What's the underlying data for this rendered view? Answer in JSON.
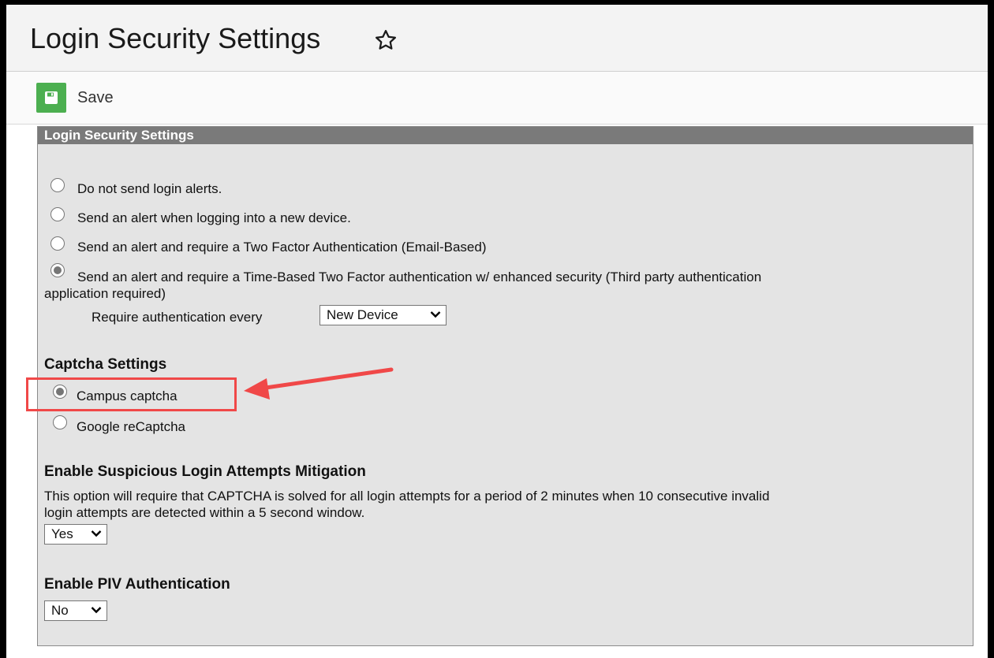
{
  "page": {
    "title": "Login Security Settings",
    "favorite_icon": "star-outline-icon"
  },
  "toolbar": {
    "save_label": "Save",
    "save_icon": "floppy-disk-icon",
    "save_color": "#4caf50"
  },
  "panel": {
    "header": "Login Security Settings",
    "alert_options": [
      {
        "label": "Do not send login alerts.",
        "checked": false
      },
      {
        "label": "Send an alert when logging into a new device.",
        "checked": false
      },
      {
        "label": "Send an alert and require a Two Factor Authentication (Email-Based)",
        "checked": false
      },
      {
        "label_line1": "Send an alert and require a Time-Based Two Factor authentication w/ enhanced security (Third party authentication",
        "label_line2": "application required)",
        "checked": true
      }
    ],
    "require_auth": {
      "label": "Require authentication every",
      "value": "New Device"
    },
    "captcha": {
      "heading": "Captcha Settings",
      "options": [
        {
          "label": "Campus captcha",
          "checked": true
        },
        {
          "label": "Google reCaptcha",
          "checked": false
        }
      ],
      "annotation_color": "#f04848"
    },
    "mitigation": {
      "heading": "Enable Suspicious Login Attempts Mitigation",
      "description_line1": "This option will require that CAPTCHA is solved for all login attempts for a period of 2 minutes when 10 consecutive invalid",
      "description_line2": "login attempts are detected within a 5 second window.",
      "value": "Yes"
    },
    "piv": {
      "heading": "Enable PIV Authentication",
      "value": "No"
    }
  }
}
